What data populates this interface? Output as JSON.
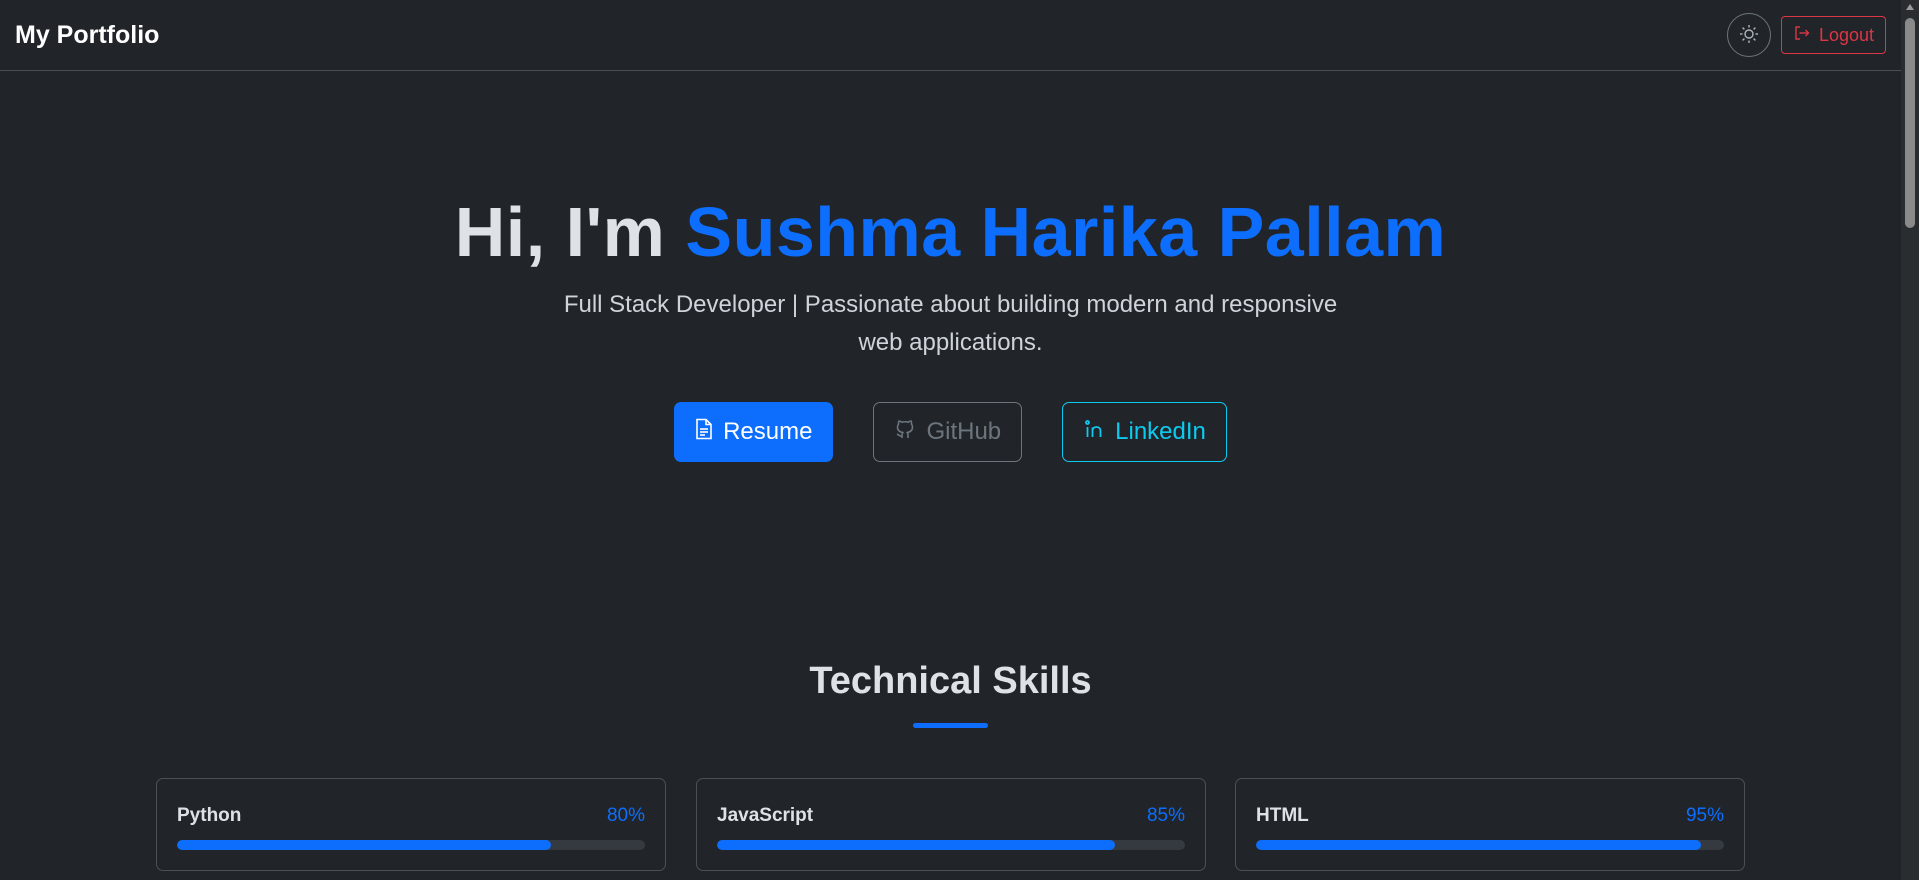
{
  "navbar": {
    "brand": "My Portfolio",
    "theme_toggle_icon": "sun-icon",
    "logout_label": "Logout",
    "logout_icon": "box-arrow-right-icon"
  },
  "hero": {
    "greeting": "Hi, I'm ",
    "name": "Sushma Harika Pallam",
    "subtitle": "Full Stack Developer | Passionate about building modern and responsive web applications.",
    "buttons": [
      {
        "label": "Resume",
        "icon": "file-text-icon"
      },
      {
        "label": "GitHub",
        "icon": "github-icon"
      },
      {
        "label": "LinkedIn",
        "icon": "linkedin-icon"
      }
    ]
  },
  "skills": {
    "title": "Technical Skills",
    "items": [
      {
        "name": "Python",
        "percent_label": "80%",
        "level": 80
      },
      {
        "name": "JavaScript",
        "percent_label": "85%",
        "level": 85
      },
      {
        "name": "HTML",
        "percent_label": "95%",
        "level": 95
      }
    ]
  },
  "colors": {
    "background": "#212529",
    "accent": "#0d6efd",
    "danger": "#dc3545",
    "info": "#0dcaf0",
    "secondary": "#6c757d"
  }
}
